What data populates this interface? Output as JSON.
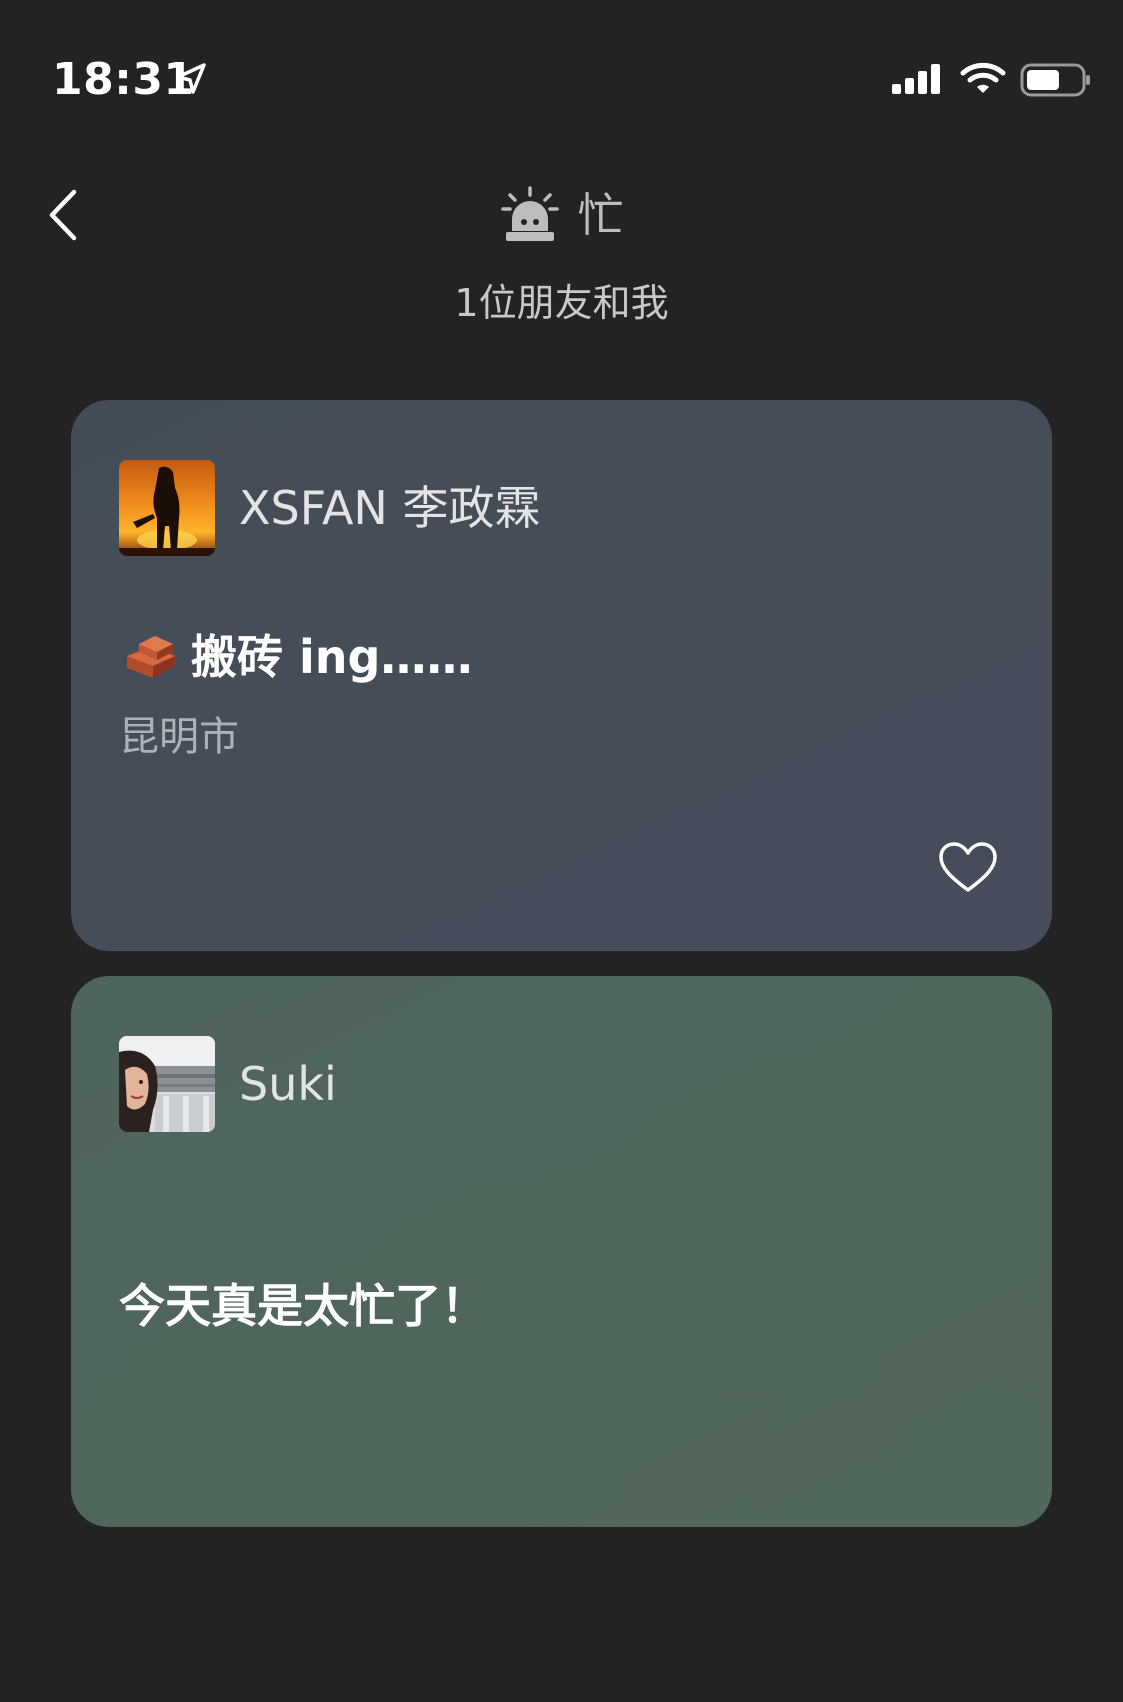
{
  "status_bar": {
    "time": "18:31",
    "icons": [
      "location-arrow-icon",
      "cellular-signal-icon",
      "wifi-icon",
      "battery-icon"
    ]
  },
  "header": {
    "back_icon": "chevron-left-icon",
    "status_icon": "siren-icon",
    "title": "忙",
    "subtitle": "1位朋友和我"
  },
  "cards": [
    {
      "user_name": "XSFAN 李政霖",
      "avatar": "sunset-silhouette-avatar",
      "status_icon": "brick-icon",
      "status_text": "搬砖 ing……",
      "location": "昆明市",
      "action_icon": "heart-outline-icon",
      "background": "#454d58"
    },
    {
      "user_name": "Suki",
      "avatar": "selfie-avatar",
      "message": "今天真是太忙了！",
      "background": "#51665b"
    }
  ],
  "colors": {
    "page_background": "#232323",
    "title_gray": "#bdbdbd",
    "location_gray": "#aeb2b8"
  }
}
